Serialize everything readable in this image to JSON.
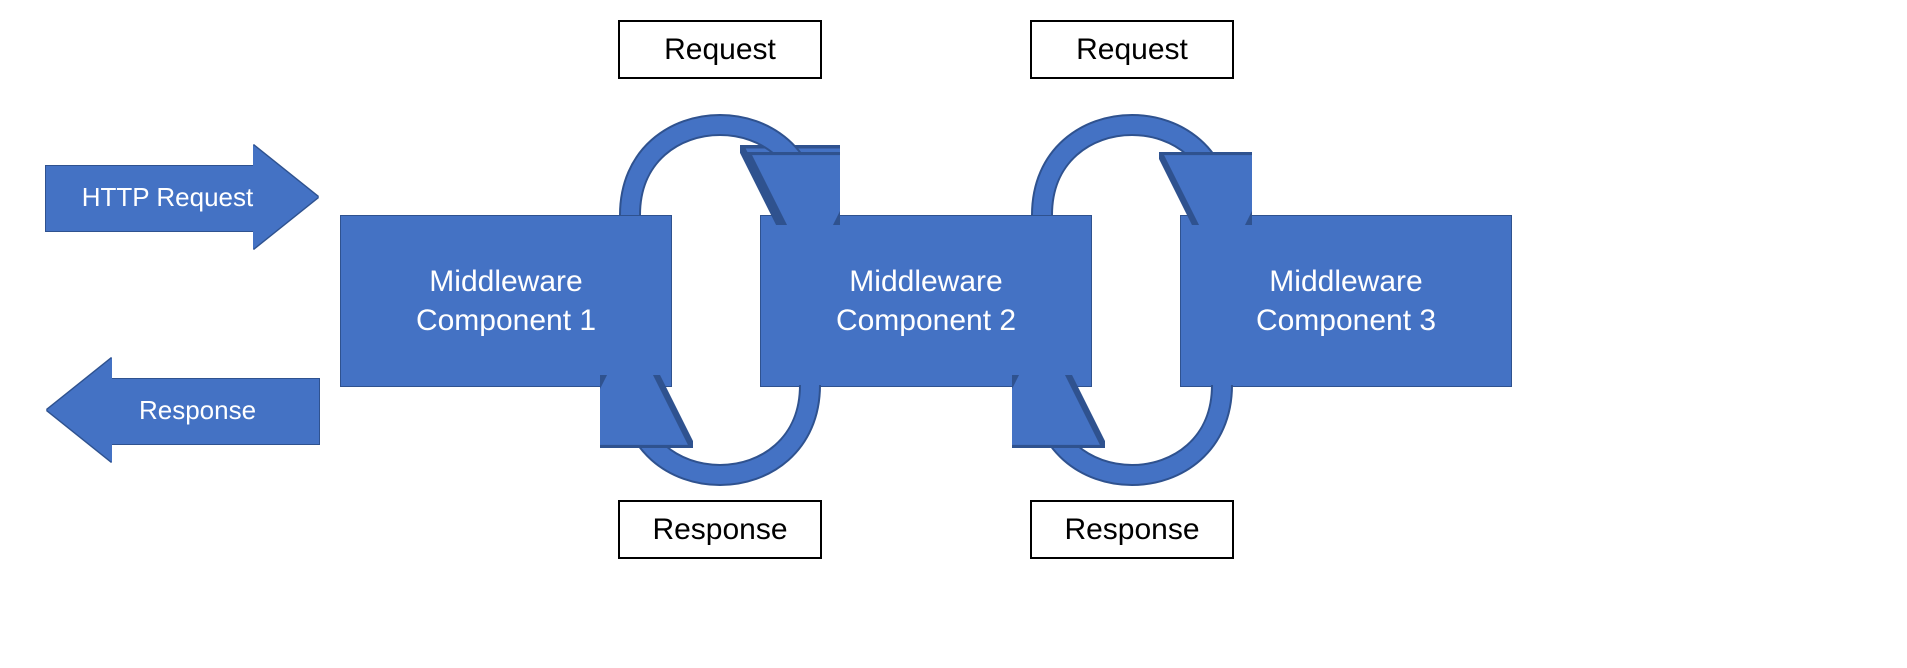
{
  "input_arrow": {
    "label": "HTTP Request"
  },
  "output_arrow": {
    "label": "Response"
  },
  "middleware": [
    {
      "title_line1": "Middleware",
      "title_line2": "Component 1"
    },
    {
      "title_line1": "Middleware",
      "title_line2": "Component 2"
    },
    {
      "title_line1": "Middleware",
      "title_line2": "Component 3"
    }
  ],
  "flow_labels": {
    "request_1_2": "Request",
    "request_2_3": "Request",
    "response_2_1": "Response",
    "response_3_2": "Response"
  },
  "colors": {
    "box_fill": "#4472C4",
    "box_border": "#2F528F",
    "arrow_fill": "#4472C4",
    "arrow_stroke": "#2F528F",
    "label_box_border": "#000000",
    "label_box_fill": "#ffffff",
    "text_on_blue": "#ffffff",
    "text_on_white": "#000000"
  }
}
